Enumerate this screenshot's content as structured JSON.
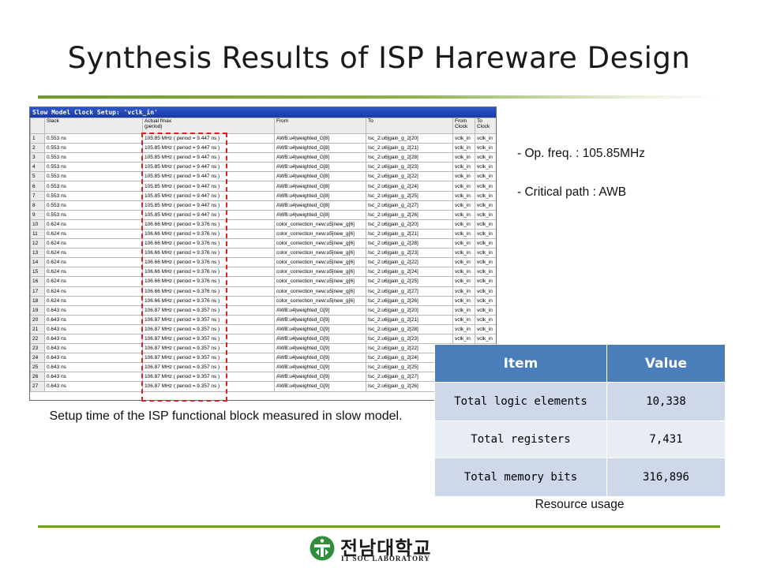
{
  "slide": {
    "title": "Synthesis Results of ISP Hareware Design"
  },
  "timing_window": {
    "title": "Slow Model Clock Setup: 'vclk_in'",
    "headers": [
      {
        "line1": "",
        "line2": ""
      },
      {
        "line1": "Slack",
        "line2": ""
      },
      {
        "line1": "Actual fmax",
        "line2": "(period)"
      },
      {
        "line1": "From",
        "line2": ""
      },
      {
        "line1": "To",
        "line2": ""
      },
      {
        "line1": "From",
        "line2": "Clock"
      },
      {
        "line1": "To",
        "line2": "Clock"
      }
    ],
    "rows": [
      [
        "1",
        "0.553 ns",
        "105.85 MHz ( period = 9.447 ns )",
        "AWB:u4|weighted_G[8]",
        "Isc_2:u6|gain_g_2[20]",
        "vclk_in",
        "vclk_in"
      ],
      [
        "2",
        "0.553 ns",
        "105.85 MHz ( period = 9.447 ns )",
        "AWB:u4|weighted_G[8]",
        "Isc_2:u6|gain_g_2[21]",
        "vclk_in",
        "vclk_in"
      ],
      [
        "3",
        "0.553 ns",
        "105.85 MHz ( period = 9.447 ns )",
        "AWB:u4|weighted_G[8]",
        "Isc_2:u6|gain_g_2[28]",
        "vclk_in",
        "vclk_in"
      ],
      [
        "4",
        "0.553 ns",
        "105.85 MHz ( period = 9.447 ns )",
        "AWB:u4|weighted_G[8]",
        "Isc_2:u6|gain_g_2[23]",
        "vclk_in",
        "vclk_in"
      ],
      [
        "5",
        "0.553 ns",
        "105.85 MHz ( period = 9.447 ns )",
        "AWB:u4|weighted_G[8]",
        "Isc_2:u6|gain_g_2[22]",
        "vclk_in",
        "vclk_in"
      ],
      [
        "6",
        "0.553 ns",
        "105.85 MHz ( period = 9.447 ns )",
        "AWB:u4|weighted_G[8]",
        "Isc_2:u6|gain_g_2[24]",
        "vclk_in",
        "vclk_in"
      ],
      [
        "7",
        "0.553 ns",
        "105.85 MHz ( period = 9.447 ns )",
        "AWB:u4|weighted_G[8]",
        "Isc_2:u6|gain_g_2[25]",
        "vclk_in",
        "vclk_in"
      ],
      [
        "8",
        "0.553 ns",
        "105.85 MHz ( period = 9.447 ns )",
        "AWB:u4|weighted_G[8]",
        "Isc_2:u6|gain_g_2[27]",
        "vclk_in",
        "vclk_in"
      ],
      [
        "9",
        "0.553 ns",
        "105.85 MHz ( period = 9.447 ns )",
        "AWB:u4|weighted_G[8]",
        "Isc_2:u6|gain_g_2[26]",
        "vclk_in",
        "vclk_in"
      ],
      [
        "10",
        "0.624 ns",
        "106.66 MHz ( period = 9.376 ns )",
        "color_correction_new:u5|new_g[6]",
        "Isc_2:u6|gain_g_2[20]",
        "vclk_in",
        "vclk_in"
      ],
      [
        "11",
        "0.624 ns",
        "106.66 MHz ( period = 9.376 ns )",
        "color_correction_new:u5|new_g[6]",
        "Isc_2:u6|gain_g_2[21]",
        "vclk_in",
        "vclk_in"
      ],
      [
        "12",
        "0.624 ns",
        "106.66 MHz ( period = 9.376 ns )",
        "color_correction_new:u5|new_g[6]",
        "Isc_2:u6|gain_g_2[28]",
        "vclk_in",
        "vclk_in"
      ],
      [
        "13",
        "0.624 ns",
        "106.66 MHz ( period = 9.376 ns )",
        "color_correction_new:u5|new_g[6]",
        "Isc_2:u6|gain_g_2[23]",
        "vclk_in",
        "vclk_in"
      ],
      [
        "14",
        "0.624 ns",
        "106.66 MHz ( period = 9.376 ns )",
        "color_correction_new:u5|new_g[6]",
        "Isc_2:u6|gain_g_2[22]",
        "vclk_in",
        "vclk_in"
      ],
      [
        "15",
        "0.624 ns",
        "106.66 MHz ( period = 9.376 ns )",
        "color_correction_new:u5|new_g[6]",
        "Isc_2:u6|gain_g_2[24]",
        "vclk_in",
        "vclk_in"
      ],
      [
        "16",
        "0.624 ns",
        "106.66 MHz ( period = 9.376 ns )",
        "color_correction_new:u5|new_g[6]",
        "Isc_2:u6|gain_g_2[25]",
        "vclk_in",
        "vclk_in"
      ],
      [
        "17",
        "0.624 ns",
        "106.66 MHz ( period = 9.376 ns )",
        "color_correction_new:u5|new_g[6]",
        "Isc_2:u6|gain_g_2[27]",
        "vclk_in",
        "vclk_in"
      ],
      [
        "18",
        "0.624 ns",
        "106.66 MHz ( period = 9.376 ns )",
        "color_correction_new:u5|new_g[6]",
        "Isc_2:u6|gain_g_2[26]",
        "vclk_in",
        "vclk_in"
      ],
      [
        "19",
        "0.643 ns",
        "106.87 MHz ( period = 9.357 ns )",
        "AWB:u4|weighted_G[9]",
        "Isc_2:u6|gain_g_2[20]",
        "vclk_in",
        "vclk_in"
      ],
      [
        "20",
        "0.643 ns",
        "106.87 MHz ( period = 9.357 ns )",
        "AWB:u4|weighted_G[9]",
        "Isc_2:u6|gain_g_2[21]",
        "vclk_in",
        "vclk_in"
      ],
      [
        "21",
        "0.643 ns",
        "106.87 MHz ( period = 9.357 ns )",
        "AWB:u4|weighted_G[9]",
        "Isc_2:u6|gain_g_2[28]",
        "vclk_in",
        "vclk_in"
      ],
      [
        "22",
        "0.643 ns",
        "106.87 MHz ( period = 9.357 ns )",
        "AWB:u4|weighted_G[9]",
        "Isc_2:u6|gain_g_2[23]",
        "vclk_in",
        "vclk_in"
      ],
      [
        "23",
        "0.643 ns",
        "106.87 MHz ( period = 9.357 ns )",
        "AWB:u4|weighted_G[9]",
        "Isc_2:u6|gain_g_2[22]",
        "vclk_in",
        "vclk_in"
      ],
      [
        "24",
        "0.643 ns",
        "106.87 MHz ( period = 9.357 ns )",
        "AWB:u4|weighted_G[9]",
        "Isc_2:u6|gain_g_2[24]",
        "vclk_in",
        "vclk_in"
      ],
      [
        "25",
        "0.643 ns",
        "106.87 MHz ( period = 9.357 ns )",
        "AWB:u4|weighted_G[9]",
        "Isc_2:u6|gain_g_2[25]",
        "vclk_in",
        "vclk_in"
      ],
      [
        "26",
        "0.643 ns",
        "106.87 MHz ( period = 9.357 ns )",
        "AWB:u4|weighted_G[9]",
        "Isc_2:u6|gain_g_2[27]",
        "vclk_in",
        "vclk_in"
      ],
      [
        "27",
        "0.643 ns",
        "106.87 MHz ( period = 9.357 ns )",
        "AWB:u4|weighted_G[9]",
        "Isc_2:u6|gain_g_2[26]",
        "vclk_in",
        "vclk_in"
      ]
    ]
  },
  "captions": {
    "timing": "Setup time of the ISP functional block measured in slow model.",
    "resource": "Resource usage"
  },
  "notes": {
    "freq": "- Op. freq. : 105.85MHz",
    "path": "- Critical path : AWB"
  },
  "resource_table": {
    "headers": [
      "Item",
      "Value"
    ],
    "rows": [
      [
        "Total logic elements",
        "10,338"
      ],
      [
        "Total registers",
        "7,431"
      ],
      [
        "Total memory bits",
        "316,896"
      ]
    ]
  },
  "footer": {
    "logo_korean": "전남대학교",
    "logo_english": "IT SOC LABORATORY",
    "logo_icon": "university-emblem-icon"
  },
  "colors": {
    "accent_green": "#6f9a2e",
    "table_header_blue": "#4a7ebb",
    "highlight_red": "#e02020"
  }
}
